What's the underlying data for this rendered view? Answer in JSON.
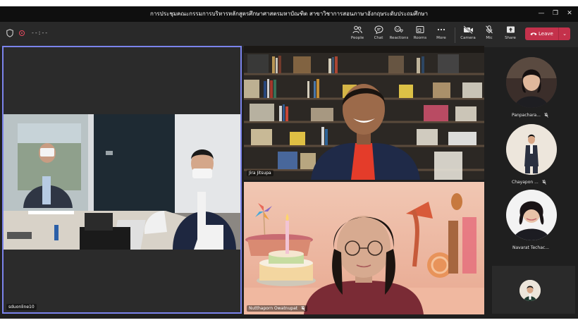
{
  "window": {
    "title": "การประชุมคณะกรรมการบริหารหลักสูตรศึกษาศาสตรมหาบัณฑิต สาขาวิชาการสอนภาษาอังกฤษระดับประถมศึกษา",
    "minimize_icon": "minimize-icon",
    "maximize_icon": "maximize-icon",
    "close_icon": "close-icon"
  },
  "toolbar": {
    "timer": "--:--",
    "buttons": {
      "people": "People",
      "chat": "Chat",
      "reactions": "Reactions",
      "rooms": "Rooms",
      "more": "More",
      "camera": "Camera",
      "mic": "Mic",
      "share": "Share"
    },
    "leave_label": "Leave"
  },
  "participants": {
    "main": [
      {
        "name": "sduonline10"
      },
      {
        "name": "Jira Jitsupa"
      },
      {
        "name": "Nutthaporn Owatnupat"
      }
    ],
    "rail": [
      {
        "name": "Panpachara..."
      },
      {
        "name": "Chayapon ..."
      },
      {
        "name": "Navarat Techac..."
      }
    ]
  },
  "colors": {
    "leave": "#c4314b",
    "active_speaker_border": "#7b83eb",
    "stage": "#1f1f1f"
  }
}
